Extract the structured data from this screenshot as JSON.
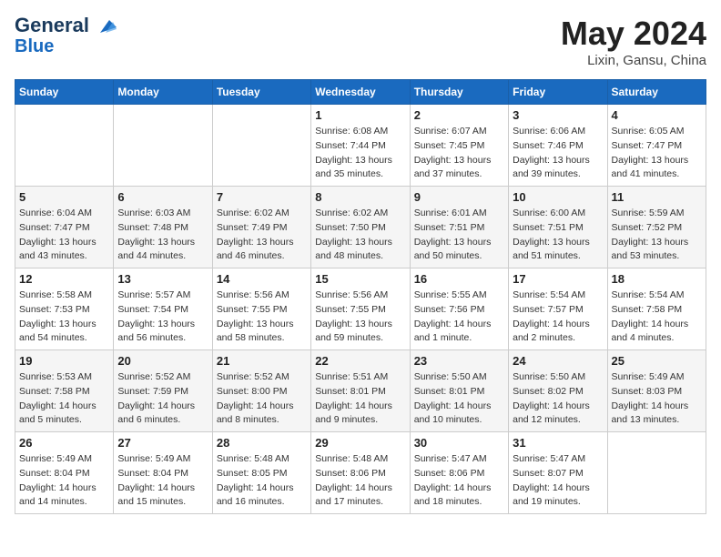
{
  "header": {
    "logo_line1": "General",
    "logo_line2": "Blue",
    "month": "May 2024",
    "location": "Lixin, Gansu, China"
  },
  "weekdays": [
    "Sunday",
    "Monday",
    "Tuesday",
    "Wednesday",
    "Thursday",
    "Friday",
    "Saturday"
  ],
  "weeks": [
    [
      {
        "day": "",
        "info": ""
      },
      {
        "day": "",
        "info": ""
      },
      {
        "day": "",
        "info": ""
      },
      {
        "day": "1",
        "info": "Sunrise: 6:08 AM\nSunset: 7:44 PM\nDaylight: 13 hours\nand 35 minutes."
      },
      {
        "day": "2",
        "info": "Sunrise: 6:07 AM\nSunset: 7:45 PM\nDaylight: 13 hours\nand 37 minutes."
      },
      {
        "day": "3",
        "info": "Sunrise: 6:06 AM\nSunset: 7:46 PM\nDaylight: 13 hours\nand 39 minutes."
      },
      {
        "day": "4",
        "info": "Sunrise: 6:05 AM\nSunset: 7:47 PM\nDaylight: 13 hours\nand 41 minutes."
      }
    ],
    [
      {
        "day": "5",
        "info": "Sunrise: 6:04 AM\nSunset: 7:47 PM\nDaylight: 13 hours\nand 43 minutes."
      },
      {
        "day": "6",
        "info": "Sunrise: 6:03 AM\nSunset: 7:48 PM\nDaylight: 13 hours\nand 44 minutes."
      },
      {
        "day": "7",
        "info": "Sunrise: 6:02 AM\nSunset: 7:49 PM\nDaylight: 13 hours\nand 46 minutes."
      },
      {
        "day": "8",
        "info": "Sunrise: 6:02 AM\nSunset: 7:50 PM\nDaylight: 13 hours\nand 48 minutes."
      },
      {
        "day": "9",
        "info": "Sunrise: 6:01 AM\nSunset: 7:51 PM\nDaylight: 13 hours\nand 50 minutes."
      },
      {
        "day": "10",
        "info": "Sunrise: 6:00 AM\nSunset: 7:51 PM\nDaylight: 13 hours\nand 51 minutes."
      },
      {
        "day": "11",
        "info": "Sunrise: 5:59 AM\nSunset: 7:52 PM\nDaylight: 13 hours\nand 53 minutes."
      }
    ],
    [
      {
        "day": "12",
        "info": "Sunrise: 5:58 AM\nSunset: 7:53 PM\nDaylight: 13 hours\nand 54 minutes."
      },
      {
        "day": "13",
        "info": "Sunrise: 5:57 AM\nSunset: 7:54 PM\nDaylight: 13 hours\nand 56 minutes."
      },
      {
        "day": "14",
        "info": "Sunrise: 5:56 AM\nSunset: 7:55 PM\nDaylight: 13 hours\nand 58 minutes."
      },
      {
        "day": "15",
        "info": "Sunrise: 5:56 AM\nSunset: 7:55 PM\nDaylight: 13 hours\nand 59 minutes."
      },
      {
        "day": "16",
        "info": "Sunrise: 5:55 AM\nSunset: 7:56 PM\nDaylight: 14 hours\nand 1 minute."
      },
      {
        "day": "17",
        "info": "Sunrise: 5:54 AM\nSunset: 7:57 PM\nDaylight: 14 hours\nand 2 minutes."
      },
      {
        "day": "18",
        "info": "Sunrise: 5:54 AM\nSunset: 7:58 PM\nDaylight: 14 hours\nand 4 minutes."
      }
    ],
    [
      {
        "day": "19",
        "info": "Sunrise: 5:53 AM\nSunset: 7:58 PM\nDaylight: 14 hours\nand 5 minutes."
      },
      {
        "day": "20",
        "info": "Sunrise: 5:52 AM\nSunset: 7:59 PM\nDaylight: 14 hours\nand 6 minutes."
      },
      {
        "day": "21",
        "info": "Sunrise: 5:52 AM\nSunset: 8:00 PM\nDaylight: 14 hours\nand 8 minutes."
      },
      {
        "day": "22",
        "info": "Sunrise: 5:51 AM\nSunset: 8:01 PM\nDaylight: 14 hours\nand 9 minutes."
      },
      {
        "day": "23",
        "info": "Sunrise: 5:50 AM\nSunset: 8:01 PM\nDaylight: 14 hours\nand 10 minutes."
      },
      {
        "day": "24",
        "info": "Sunrise: 5:50 AM\nSunset: 8:02 PM\nDaylight: 14 hours\nand 12 minutes."
      },
      {
        "day": "25",
        "info": "Sunrise: 5:49 AM\nSunset: 8:03 PM\nDaylight: 14 hours\nand 13 minutes."
      }
    ],
    [
      {
        "day": "26",
        "info": "Sunrise: 5:49 AM\nSunset: 8:04 PM\nDaylight: 14 hours\nand 14 minutes."
      },
      {
        "day": "27",
        "info": "Sunrise: 5:49 AM\nSunset: 8:04 PM\nDaylight: 14 hours\nand 15 minutes."
      },
      {
        "day": "28",
        "info": "Sunrise: 5:48 AM\nSunset: 8:05 PM\nDaylight: 14 hours\nand 16 minutes."
      },
      {
        "day": "29",
        "info": "Sunrise: 5:48 AM\nSunset: 8:06 PM\nDaylight: 14 hours\nand 17 minutes."
      },
      {
        "day": "30",
        "info": "Sunrise: 5:47 AM\nSunset: 8:06 PM\nDaylight: 14 hours\nand 18 minutes."
      },
      {
        "day": "31",
        "info": "Sunrise: 5:47 AM\nSunset: 8:07 PM\nDaylight: 14 hours\nand 19 minutes."
      },
      {
        "day": "",
        "info": ""
      }
    ]
  ]
}
